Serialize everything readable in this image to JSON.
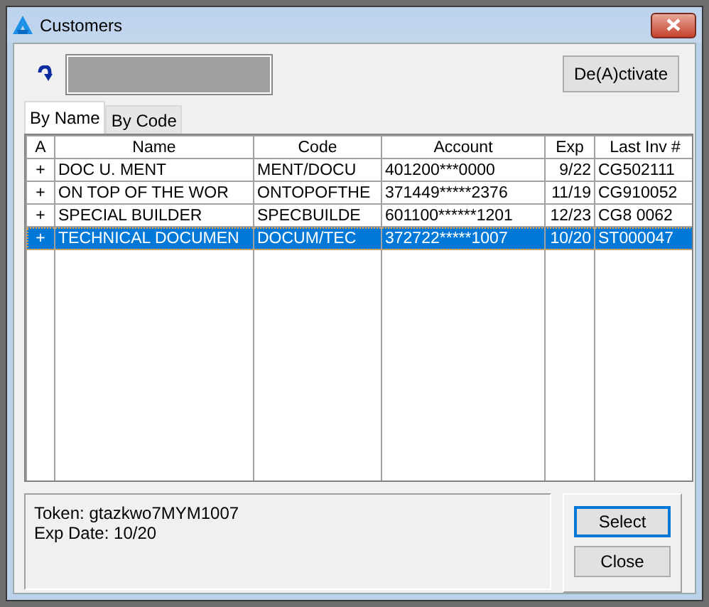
{
  "window": {
    "title": "Customers"
  },
  "toolbar": {
    "deactivate_button": "De(A)ctivate"
  },
  "tabs": [
    {
      "label": "By Name",
      "selected": true
    },
    {
      "label": "By Code",
      "selected": false
    }
  ],
  "table": {
    "columns": [
      "A",
      "Name",
      "Code",
      "Account",
      "Exp",
      "Last Inv #"
    ],
    "rows": [
      {
        "cells": [
          "+",
          "DOC U. MENT",
          "MENT/DOCU",
          "401200***0000",
          "9/22",
          "CG502111"
        ],
        "selected": false
      },
      {
        "cells": [
          "+",
          "ON TOP OF THE WOR",
          "ONTOPOFTHE",
          "371449*****2376",
          "11/19",
          "CG910052"
        ],
        "selected": false
      },
      {
        "cells": [
          "+",
          "SPECIAL BUILDER",
          "SPECBUILDE",
          "601100******1201",
          "12/23",
          "CG8 0062"
        ],
        "selected": false
      },
      {
        "cells": [
          "+",
          "TECHNICAL DOCUMEN",
          "DOCUM/TEC",
          "372722*****1007",
          "10/20",
          "ST000047"
        ],
        "selected": true
      }
    ]
  },
  "details": [
    "Token: gtazkwo7MYM1007",
    "Exp Date: 10/20"
  ],
  "buttons": [
    {
      "label": "Select",
      "default": true
    },
    {
      "label": "Close",
      "default": false
    }
  ]
}
